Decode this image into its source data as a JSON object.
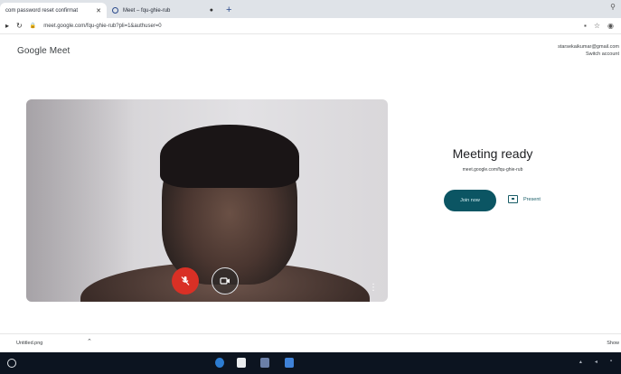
{
  "browser": {
    "tabs": [
      {
        "label": "com password reset confirmat",
        "close": "✕"
      },
      {
        "label": "Meet – fqu-ghie-rub",
        "close": "●"
      }
    ],
    "new_tab": "+",
    "url": "meet.google.com/fqu-ghie-rub?pli=1&authuser=0"
  },
  "meet": {
    "logo": "Google Meet",
    "account_email": "starsekaikumar@gmail.com",
    "account_switch": "Switch account",
    "ready_title": "Meeting ready",
    "meeting_link": "meet.google.com/fqu-ghie-rub",
    "join_label": "Join now",
    "present_label": "Present"
  },
  "downloads": {
    "file_name": "Untitled.png",
    "show_all": "Show"
  },
  "colors": {
    "mic_off": "#d93025",
    "join_button": "#0b5563",
    "taskbar": "#0c1420"
  },
  "icons": {
    "mic": "mic-off-icon",
    "camera": "camera-icon",
    "more": "more-vert-icon",
    "present": "present-screen-icon"
  }
}
